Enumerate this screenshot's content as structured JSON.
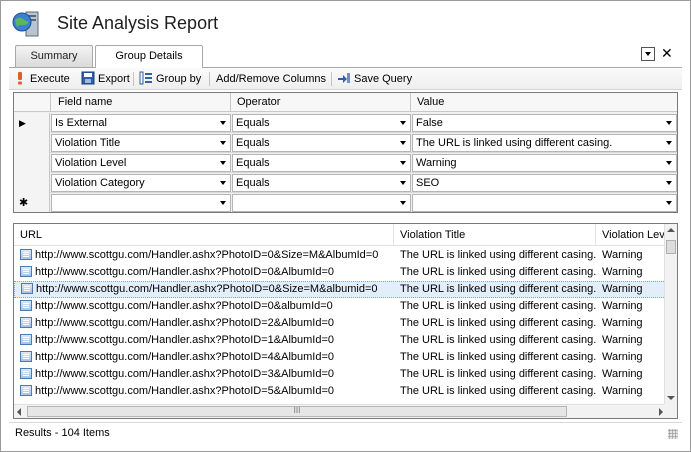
{
  "window": {
    "title": "Site Analysis Report"
  },
  "tabs": [
    {
      "label": "Summary",
      "active": false
    },
    {
      "label": "Group Details",
      "active": true
    }
  ],
  "toolbar": {
    "execute": "Execute",
    "export": "Export",
    "group_by": "Group by",
    "add_remove_columns": "Add/Remove Columns",
    "save_query": "Save Query"
  },
  "query": {
    "columns": [
      "Field name",
      "Operator",
      "Value"
    ],
    "rows": [
      {
        "marker": "▶",
        "field": "Is External",
        "operator": "Equals",
        "value": "False"
      },
      {
        "marker": "",
        "field": "Violation Title",
        "operator": "Equals",
        "value": "The URL is linked using different casing."
      },
      {
        "marker": "",
        "field": "Violation Level",
        "operator": "Equals",
        "value": "Warning"
      },
      {
        "marker": "",
        "field": "Violation Category",
        "operator": "Equals",
        "value": "SEO"
      },
      {
        "marker": "✱",
        "field": "",
        "operator": "",
        "value": ""
      }
    ]
  },
  "results": {
    "columns": [
      "URL",
      "Violation Title",
      "Violation Lev"
    ],
    "rows": [
      {
        "url": "http://www.scottgu.com/Handler.ashx?PhotoID=0&Size=M&AlbumId=0",
        "title": "The URL is linked using different casing.",
        "level": "Warning",
        "selected": false
      },
      {
        "url": "http://www.scottgu.com/Handler.ashx?PhotoID=0&AlbumId=0",
        "title": "The URL is linked using different casing.",
        "level": "Warning",
        "selected": false
      },
      {
        "url": "http://www.scottgu.com/Handler.ashx?PhotoID=0&Size=M&albumid=0",
        "title": "The URL is linked using different casing.",
        "level": "Warning",
        "selected": true
      },
      {
        "url": "http://www.scottgu.com/Handler.ashx?PhotoID=0&albumId=0",
        "title": "The URL is linked using different casing.",
        "level": "Warning",
        "selected": false
      },
      {
        "url": "http://www.scottgu.com/Handler.ashx?PhotoID=2&AlbumId=0",
        "title": "The URL is linked using different casing.",
        "level": "Warning",
        "selected": false
      },
      {
        "url": "http://www.scottgu.com/Handler.ashx?PhotoID=1&AlbumId=0",
        "title": "The URL is linked using different casing.",
        "level": "Warning",
        "selected": false
      },
      {
        "url": "http://www.scottgu.com/Handler.ashx?PhotoID=4&AlbumId=0",
        "title": "The URL is linked using different casing.",
        "level": "Warning",
        "selected": false
      },
      {
        "url": "http://www.scottgu.com/Handler.ashx?PhotoID=3&AlbumId=0",
        "title": "The URL is linked using different casing.",
        "level": "Warning",
        "selected": false
      },
      {
        "url": "http://www.scottgu.com/Handler.ashx?PhotoID=5&AlbumId=0",
        "title": "The URL is linked using different casing.",
        "level": "Warning",
        "selected": false
      }
    ],
    "scroll_grip": "III"
  },
  "status": {
    "text": "Results - 104 Items"
  },
  "colors": {
    "selection": "#e2effb",
    "accent": "#4a7bb5"
  }
}
